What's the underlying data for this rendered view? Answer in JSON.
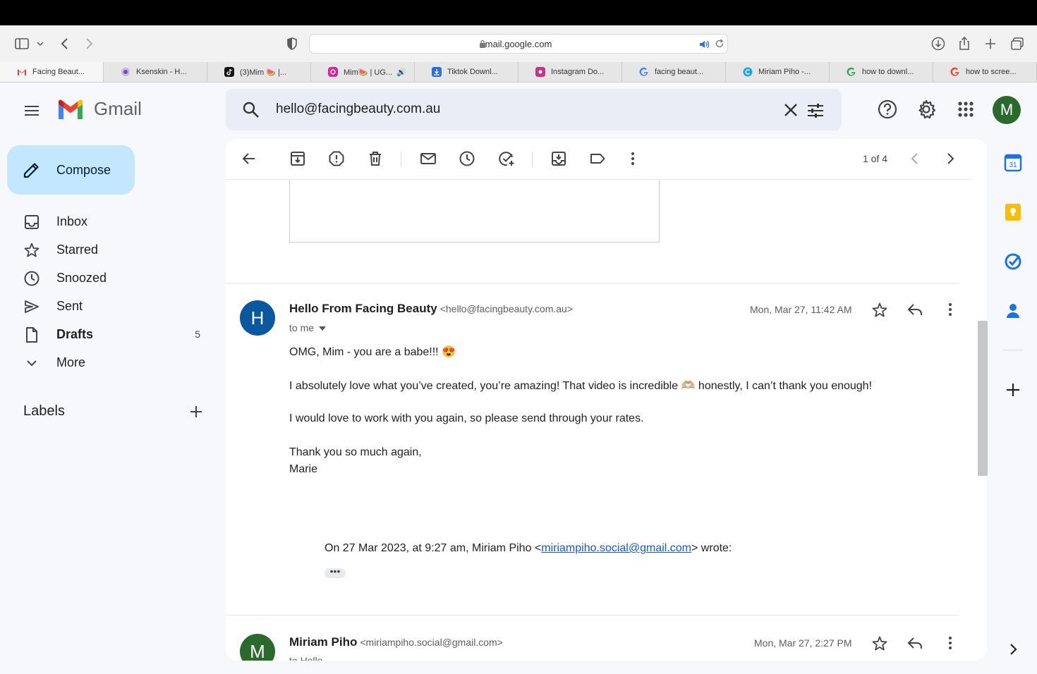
{
  "browser": {
    "url": "mail.google.com",
    "tabs": [
      {
        "label": "Facing Beaut...",
        "active": true,
        "favicon": "gmail"
      },
      {
        "label": "Ksenskin - H...",
        "favicon": "ksenskin"
      },
      {
        "label": "(3)Mim 🍉 |...",
        "favicon": "tiktok"
      },
      {
        "label": "Mim🍉 | UG...",
        "favicon": "instagram",
        "audio": "🔊"
      },
      {
        "label": "Tiktok Downl...",
        "favicon": "download"
      },
      {
        "label": "Instagram Do...",
        "favicon": "instagram-dl"
      },
      {
        "label": "facing beaut...",
        "favicon": "google"
      },
      {
        "label": "Miriam Piho -...",
        "favicon": "canva"
      },
      {
        "label": "how to downl...",
        "favicon": "google"
      },
      {
        "label": "how to scree...",
        "favicon": "google"
      }
    ]
  },
  "gmail": {
    "logo_text": "Gmail",
    "search_query": "hello@facingbeauty.com.au",
    "avatar_initial": "M"
  },
  "sidebar": {
    "compose_label": "Compose",
    "items": [
      {
        "label": "Inbox",
        "icon": "inbox-icon"
      },
      {
        "label": "Starred",
        "icon": "star-icon"
      },
      {
        "label": "Snoozed",
        "icon": "clock-icon"
      },
      {
        "label": "Sent",
        "icon": "send-icon"
      },
      {
        "label": "Drafts",
        "icon": "draft-icon",
        "count": "5"
      },
      {
        "label": "More",
        "icon": "chevron-down-icon"
      }
    ],
    "labels_title": "Labels"
  },
  "toolbar": {
    "pager": "1 of 4"
  },
  "messages": [
    {
      "avatar": "H",
      "avatar_color": "#0b57a0",
      "sender": "Hello From Facing Beauty",
      "address": "<hello@facingbeauty.com.au>",
      "date": "Mon, Mar 27, 11:42 AM",
      "to": "to me",
      "body": [
        "OMG, Mim - you are a babe!!! 😍",
        "I absolutely love what you’ve created, you’re amazing! That video is incredible 🫶🏼 honestly, I can’t thank you enough!",
        "I would love to work with you again, so please send through your rates.",
        "Thank you so much again,",
        "Marie"
      ],
      "quote_prefix": "On 27 Mar 2023, at 9:27 am, Miriam Piho <",
      "quote_link": "miriampiho.social@gmail.com",
      "quote_suffix": "> wrote:",
      "ellipsis": "•••"
    },
    {
      "avatar": "M",
      "avatar_color": "#2a6a2c",
      "sender": "Miriam Piho",
      "address": "<miriampiho.social@gmail.com>",
      "date": "Mon, Mar 27, 2:27 PM",
      "to": "to Hello"
    }
  ],
  "sidepanel": {
    "calendar_day": "31"
  }
}
